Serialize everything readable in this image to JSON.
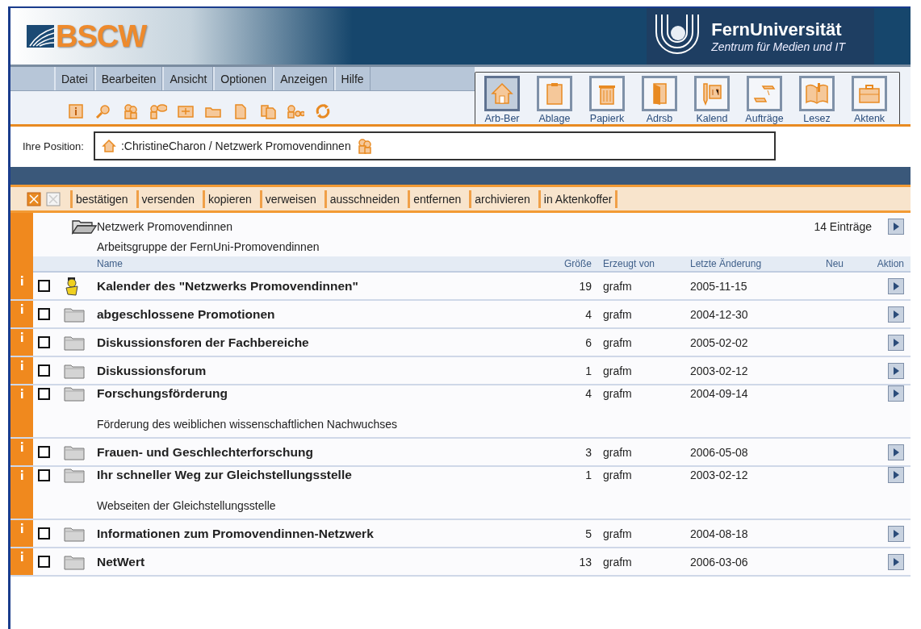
{
  "header": {
    "logo_text": "BSCW",
    "org_name": "FernUniversität",
    "org_subtitle": "Zentrum für Medien und IT"
  },
  "menu": [
    "Datei",
    "Bearbeiten",
    "Ansicht",
    "Optionen",
    "Anzeigen",
    "Hilfe"
  ],
  "nav_buttons": [
    {
      "label": "Arb-Ber",
      "kind": "home",
      "selected": true
    },
    {
      "label": "Ablage",
      "kind": "clipboard",
      "selected": false
    },
    {
      "label": "Papierk",
      "kind": "trash",
      "selected": false
    },
    {
      "label": "Adrsb",
      "kind": "book",
      "selected": false
    },
    {
      "label": "Kalend",
      "kind": "calendar",
      "selected": false
    },
    {
      "label": "Aufträge",
      "kind": "tasks",
      "selected": false
    },
    {
      "label": "Lesez",
      "kind": "reader",
      "selected": false
    },
    {
      "label": "Aktenk",
      "kind": "briefcase",
      "selected": false
    }
  ],
  "position": {
    "label": "Ihre Position:",
    "path": ":ChristineCharon / Netzwerk Promovendinnen"
  },
  "actions": [
    "bestätigen",
    "versenden",
    "kopieren",
    "verweisen",
    "ausschneiden",
    "entfernen",
    "archivieren",
    "in Aktenkoffer"
  ],
  "folder": {
    "name": "Netzwerk Promovendinnen",
    "count": "14 Einträge",
    "description": "Arbeitsgruppe der FernUni-Promovendinnen"
  },
  "columns": [
    "Name",
    "Größe",
    "Erzeugt von",
    "Letzte Änderung",
    "Neu",
    "Aktion"
  ],
  "rows": [
    {
      "kind": "calendar",
      "name": "Kalender des \"Netzwerks Promovendinnen\"",
      "size": "19",
      "creator": "grafm",
      "modified": "2005-11-15",
      "checked": false
    },
    {
      "kind": "folder",
      "name": "abgeschlossene Promotionen",
      "size": "4",
      "creator": "grafm",
      "modified": "2004-12-30",
      "checked": false
    },
    {
      "kind": "folder",
      "name": "Diskussionsforen der Fachbereiche",
      "size": "6",
      "creator": "grafm",
      "modified": "2005-02-02",
      "checked": false
    },
    {
      "kind": "folder",
      "name": "Diskussionsforum",
      "size": "1",
      "creator": "grafm",
      "modified": "2003-02-12",
      "checked": false
    },
    {
      "kind": "folder",
      "name": "Forschungsförderung",
      "size": "4",
      "creator": "grafm",
      "modified": "2004-09-14",
      "checked": false,
      "description": "Förderung des weiblichen wissenschaftlichen Nachwuchses"
    },
    {
      "kind": "folder",
      "name": "Frauen- und Geschlechterforschung",
      "size": "3",
      "creator": "grafm",
      "modified": "2006-05-08",
      "checked": false
    },
    {
      "kind": "folder",
      "name": "Ihr schneller Weg zur Gleichstellungsstelle",
      "size": "1",
      "creator": "grafm",
      "modified": "2003-02-12",
      "checked": false,
      "description": "Webseiten der Gleichstellungsstelle"
    },
    {
      "kind": "folder",
      "name": "Informationen zum Promovendinnen-Netzwerk",
      "size": "5",
      "creator": "grafm",
      "modified": "2004-08-18",
      "checked": false
    },
    {
      "kind": "folder",
      "name": "NetWert",
      "size": "13",
      "creator": "grafm",
      "modified": "2006-03-06",
      "checked": false
    }
  ]
}
